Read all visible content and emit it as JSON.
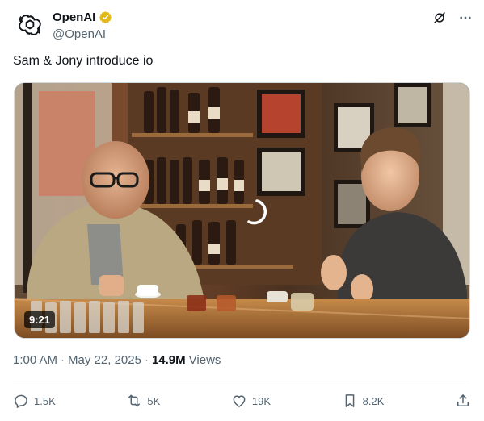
{
  "account": {
    "display_name": "OpenAI",
    "handle": "@OpenAI",
    "avatar_icon": "openai-logo-icon",
    "verified_color": "#e2b719"
  },
  "header_icons": [
    "grok-icon",
    "more-icon"
  ],
  "tweet": {
    "text": "Sam & Jony introduce io"
  },
  "media": {
    "duration": "9:21",
    "loading_icon": "spinner-icon"
  },
  "meta": {
    "time": "1:00 AM",
    "separator1": "·",
    "date": "May 22, 2025",
    "separator2": "·",
    "views_count": "14.9M",
    "views_label": "Views"
  },
  "actions": {
    "replies": "1.5K",
    "reposts": "5K",
    "likes": "19K",
    "bookmarks": "8.2K"
  },
  "colors": {
    "text_primary": "#0f1419",
    "text_secondary": "#536471",
    "divider": "#eff3f4"
  }
}
